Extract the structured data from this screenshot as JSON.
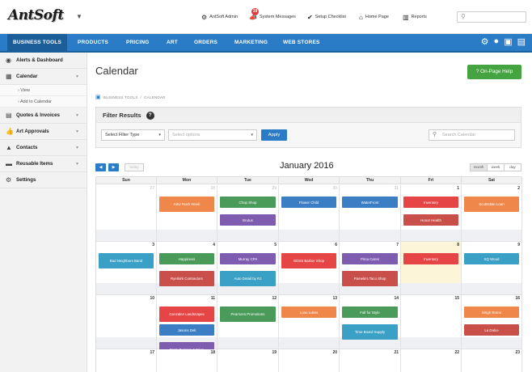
{
  "app": {
    "logo_text": "AntSoft",
    "top_nav": [
      {
        "icon": "gear-badge-icon",
        "label": "AntSoft Admin"
      },
      {
        "icon": "megaphone-icon",
        "label": "System Messages",
        "badge": "19"
      },
      {
        "icon": "check-circle-icon",
        "label": "Setup Checklist"
      },
      {
        "icon": "home-icon",
        "label": "Home Page"
      },
      {
        "icon": "chart-icon",
        "label": "Reports"
      }
    ],
    "search_placeholder": ""
  },
  "main_nav": {
    "items": [
      "BUSINESS TOOLS",
      "PRODUCTS",
      "PRICING",
      "ART",
      "ORDERS",
      "MARKETING",
      "WEB STORES"
    ],
    "active": "BUSINESS TOOLS",
    "icons": [
      "gear-icon",
      "user-icon",
      "save-icon",
      "document-icon"
    ]
  },
  "sidebar": {
    "items": [
      {
        "icon": "dashboard-icon",
        "label": "Alerts & Dashboard"
      },
      {
        "icon": "calendar-icon",
        "label": "Calendar",
        "sub": [
          "View",
          "Add to Calendar"
        ]
      },
      {
        "icon": "invoice-icon",
        "label": "Quotes & Invoices"
      },
      {
        "icon": "thumbs-icon",
        "label": "Art Approvals"
      },
      {
        "icon": "contacts-icon",
        "label": "Contacts"
      },
      {
        "icon": "items-icon",
        "label": "Reusable Items"
      },
      {
        "icon": "settings-icon",
        "label": "Settings"
      }
    ]
  },
  "page": {
    "title": "Calendar",
    "help_button": "? On-Page Help",
    "breadcrumb": [
      "BUSINESS TOOLS",
      "/",
      "CALENDAR"
    ]
  },
  "filter": {
    "title": "Filter Results",
    "filter_type": "Select Filter Type",
    "options_placeholder": "Select options",
    "apply": "Apply",
    "search_placeholder": "Search Calendar"
  },
  "calendar": {
    "prev": "◀",
    "next": "▶",
    "today_btn": "today",
    "month_title": "January 2016",
    "views": [
      "month",
      "week",
      "day"
    ],
    "active_view": "month",
    "day_names": [
      "Sun",
      "Mon",
      "Tue",
      "Wed",
      "Thu",
      "Fri",
      "Sat"
    ],
    "weeks": [
      [
        {
          "n": "27",
          "other": true
        },
        {
          "n": "28",
          "other": true
        },
        {
          "n": "29",
          "other": true
        },
        {
          "n": "30",
          "other": true
        },
        {
          "n": "31",
          "other": true
        },
        {
          "n": "1"
        },
        {
          "n": "2"
        }
      ],
      [
        {
          "n": "3"
        },
        {
          "n": "4"
        },
        {
          "n": "5"
        },
        {
          "n": "6"
        },
        {
          "n": "7"
        },
        {
          "n": "8",
          "today": true
        },
        {
          "n": "9"
        }
      ],
      [
        {
          "n": "10"
        },
        {
          "n": "11"
        },
        {
          "n": "12"
        },
        {
          "n": "13"
        },
        {
          "n": "14"
        },
        {
          "n": "15"
        },
        {
          "n": "16"
        }
      ],
      [
        {
          "n": "17"
        },
        {
          "n": "18"
        },
        {
          "n": "19"
        },
        {
          "n": "20"
        },
        {
          "n": "21"
        },
        {
          "n": "22"
        },
        {
          "n": "23"
        }
      ]
    ],
    "events": [
      {
        "week": 0,
        "day": 1,
        "slot": 0,
        "label": "ASU Rush Week",
        "color": "#f0874a",
        "tall": true
      },
      {
        "week": 0,
        "day": 2,
        "slot": 0,
        "label": "Chop Shop",
        "color": "#4a9a5a"
      },
      {
        "week": 0,
        "day": 2,
        "slot": 1,
        "label": "Brutus",
        "color": "#7e5cb0"
      },
      {
        "week": 0,
        "day": 3,
        "slot": 0,
        "label": "Flower Child",
        "color": "#3b7ec4"
      },
      {
        "week": 0,
        "day": 4,
        "slot": 0,
        "label": "WaterFront",
        "color": "#3b7ec4"
      },
      {
        "week": 0,
        "day": 5,
        "slot": 0,
        "label": "Inventory",
        "color": "#e64545"
      },
      {
        "week": 0,
        "day": 5,
        "slot": 1,
        "label": "Honor Health",
        "color": "#c9504a"
      },
      {
        "week": 0,
        "day": 6,
        "slot": 0,
        "label": "Scottsdale Loan",
        "color": "#f0874a",
        "tall": true
      },
      {
        "week": 1,
        "day": 0,
        "slot": 0,
        "label": "Bad Neighbors Band",
        "color": "#3aa0c6",
        "tall": true
      },
      {
        "week": 1,
        "day": 1,
        "slot": 0,
        "label": "Happiness",
        "color": "#4a9a5a"
      },
      {
        "week": 1,
        "day": 1,
        "slot": 1,
        "label": "Ryerkirk Contractors",
        "color": "#c9504a",
        "tall": true
      },
      {
        "week": 1,
        "day": 2,
        "slot": 0,
        "label": "Murray CPA",
        "color": "#7e5cb0"
      },
      {
        "week": 1,
        "day": 2,
        "slot": 1,
        "label": "Auto Detail by RJ",
        "color": "#3aa0c6",
        "tall": true
      },
      {
        "week": 1,
        "day": 3,
        "slot": 0,
        "label": "BOSS Barber Shop",
        "color": "#e64545",
        "tall": true
      },
      {
        "week": 1,
        "day": 4,
        "slot": 0,
        "label": "Pima Cares",
        "color": "#7e5cb0"
      },
      {
        "week": 1,
        "day": 4,
        "slot": 1,
        "label": "Pamela's Taco Shop",
        "color": "#c9504a",
        "tall": true
      },
      {
        "week": 1,
        "day": 5,
        "slot": 0,
        "label": "Inventory",
        "color": "#e64545"
      },
      {
        "week": 1,
        "day": 6,
        "slot": 0,
        "label": "SQ Wood",
        "color": "#3aa0c6"
      },
      {
        "week": 2,
        "day": 1,
        "slot": 0,
        "label": "Gonzales Landscapes",
        "color": "#e64545",
        "tall": true
      },
      {
        "week": 2,
        "day": 1,
        "slot": 1,
        "label": "Jasons Deli",
        "color": "#3b7ec4"
      },
      {
        "week": 2,
        "day": 1,
        "slot": 2,
        "label": "Farm Burgers & Fries",
        "color": "#7e5cb0",
        "tall": true
      },
      {
        "week": 2,
        "day": 2,
        "slot": 0,
        "label": "Pearsons Promotions",
        "color": "#4a9a5a",
        "tall": true
      },
      {
        "week": 2,
        "day": 3,
        "slot": 0,
        "label": "Luau Lukes",
        "color": "#f0874a"
      },
      {
        "week": 2,
        "day": 4,
        "slot": 0,
        "label": "Fall for Style",
        "color": "#4a9a5a"
      },
      {
        "week": 2,
        "day": 4,
        "slot": 1,
        "label": "Time Board Supply",
        "color": "#3aa0c6",
        "tall": true
      },
      {
        "week": 2,
        "day": 6,
        "slot": 0,
        "label": "Singh Roma",
        "color": "#f0874a"
      },
      {
        "week": 2,
        "day": 6,
        "slot": 1,
        "label": "La Dolce",
        "color": "#c9504a"
      }
    ]
  }
}
